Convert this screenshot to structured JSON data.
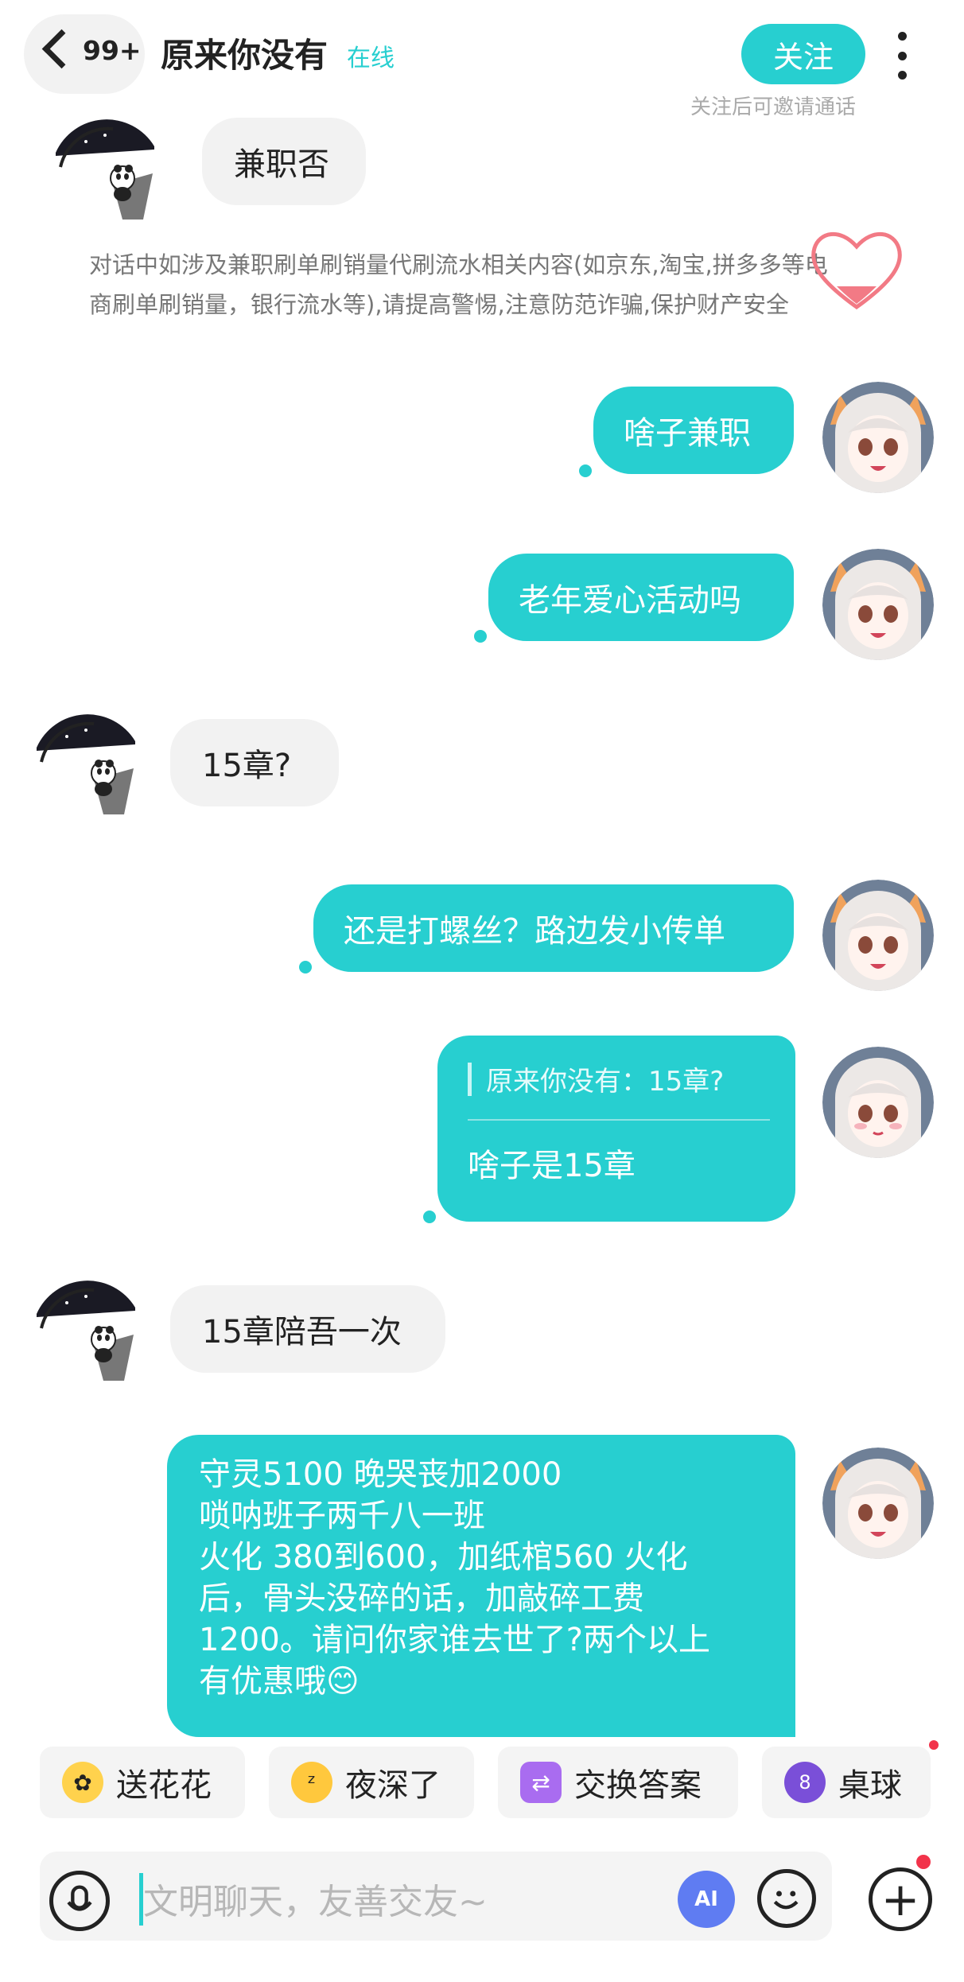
{
  "header": {
    "badge_count": "99+",
    "title": "原来你没有",
    "status": "在线",
    "follow_label": "关注",
    "follow_hint": "关注后可邀请通话"
  },
  "warning": {
    "line1": "对话中如涉及兼职刷单刷销量代刷流水相关内容(如京东,淘宝,拼多多等电",
    "line2": "商刷单刷销量，银行流水等),请提高警惕,注意防范诈骗,保护财产安全"
  },
  "messages": {
    "m1": "兼职否",
    "m2": "啥子兼职",
    "m3": "老年爱心活动吗",
    "m4": "15章?",
    "m5": "还是打螺丝？路边发小传单",
    "m6_quote": "原来你没有：15章?",
    "m6_reply": "啥子是15章",
    "m7": "15章陪吾一次",
    "m8_lines": [
      "守灵5100 晚哭丧加2000",
      "唢呐班子两千八一班",
      "火化 380到600，加纸棺560 火化",
      "后，骨头没碎的话，加敲碎工费",
      "1200。请问你家谁去世了?两个以上",
      "有优惠哦😊"
    ]
  },
  "quick_actions": [
    {
      "label": "送花花",
      "icon": "flower-emoji-icon"
    },
    {
      "label": "夜深了",
      "icon": "sleepy-emoji-icon"
    },
    {
      "label": "交换答案",
      "icon": "exchange-icon"
    },
    {
      "label": "桌球",
      "icon": "billiards-8-ball-icon"
    }
  ],
  "input": {
    "placeholder": "文明聊天，友善交友~"
  },
  "colors": {
    "accent": "#27cfd0",
    "incoming_bubble": "#f2f2f2",
    "notification": "#f2334a"
  }
}
